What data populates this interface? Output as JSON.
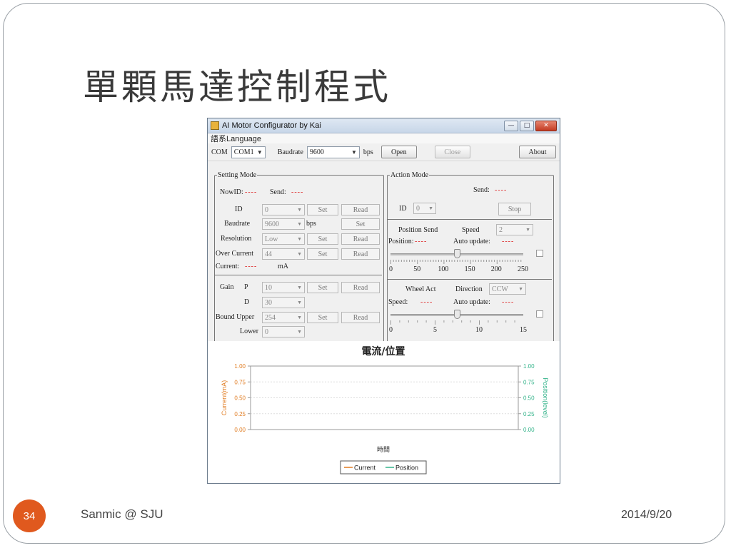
{
  "slide": {
    "title": "單顆馬達控制程式",
    "page_number": "34",
    "footer_left": "Sanmic @ SJU",
    "footer_right": "2014/9/20"
  },
  "window": {
    "title": "AI Motor Configurator by Kai",
    "menu": "語系Language",
    "buttons": [
      "—",
      "□",
      "✕"
    ]
  },
  "toolbar": {
    "com_label": "COM",
    "com_value": "COM1",
    "baud_label": "Baudrate",
    "baud_value": "9600",
    "bps": "bps",
    "open": "Open",
    "close": "Close",
    "about": "About"
  },
  "setting": {
    "legend": "Setting Mode",
    "nowid_label": "NowID:",
    "nowid_value": "----",
    "send_label": "Send:",
    "send_value": "----",
    "id_label": "ID",
    "id_value": "0",
    "baud_label": "Baudrate",
    "baud_value": "9600",
    "baud_unit": "bps",
    "res_label": "Resolution",
    "res_value": "Low",
    "oc_label": "Over Current",
    "oc_value": "44",
    "current_label": "Current:",
    "current_value": "----",
    "current_unit": "mA",
    "gain_label": "Gain",
    "p_label": "P",
    "p_value": "10",
    "d_label": "D",
    "d_value": "30",
    "bound_label": "Bound Upper",
    "upper_value": "254",
    "lower_label": "Lower",
    "lower_value": "0",
    "set": "Set",
    "read": "Read"
  },
  "action": {
    "legend": "Action Mode",
    "send_label": "Send:",
    "send_value": "----",
    "id_label": "ID",
    "id_value": "0",
    "stop": "Stop",
    "pos_send": "Position Send",
    "speed_label": "Speed",
    "speed_value": "2",
    "position_label": "Position:",
    "position_value": "----",
    "auto_label": "Auto update:",
    "auto_value": "----",
    "pos_ticks": [
      "0",
      "50",
      "100",
      "150",
      "200",
      "250"
    ],
    "pos_slider": 0.5,
    "wheel_act": "Wheel Act",
    "direction_label": "Direction",
    "direction_value": "CCW",
    "wheel_speed_label": "Speed:",
    "wheel_speed_value": "----",
    "wheel_auto_label": "Auto update:",
    "wheel_auto_value": "----",
    "wheel_ticks": [
      "0",
      "5",
      "10",
      "15"
    ],
    "wheel_slider": 0.5
  },
  "colors": {
    "current": "#e07b20",
    "position": "#33b38a",
    "accent": "#e0591e"
  },
  "chart_data": {
    "type": "line",
    "title": "電流/位置",
    "xlabel": "時間",
    "ylabel": "Current(mA)",
    "y2label": "Position(level)",
    "ylim": [
      0,
      1
    ],
    "y2lim": [
      0,
      1
    ],
    "yticks": [
      "1.00",
      "0.75",
      "0.50",
      "0.25",
      "0.00"
    ],
    "y2ticks": [
      "1.00",
      "0.75",
      "0.50",
      "0.25",
      "0.00"
    ],
    "series": [
      {
        "name": "Current",
        "values": []
      },
      {
        "name": "Position",
        "values": []
      }
    ],
    "legend": "bottom"
  }
}
